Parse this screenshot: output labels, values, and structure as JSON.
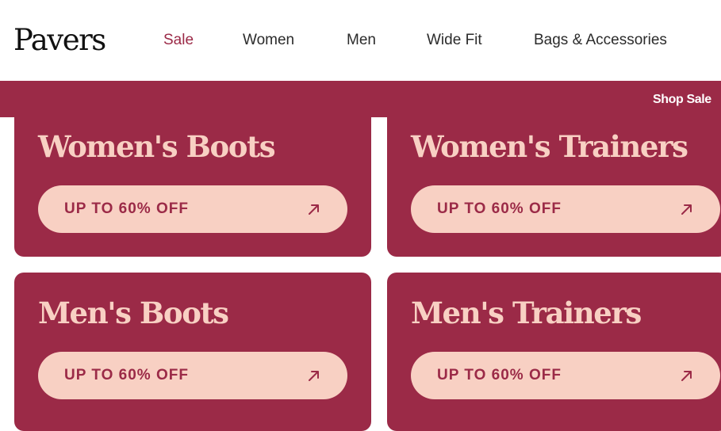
{
  "header": {
    "logo": "Pavers",
    "nav": [
      {
        "label": "Sale",
        "active": true
      },
      {
        "label": "Women",
        "active": false
      },
      {
        "label": "Men",
        "active": false
      },
      {
        "label": "Wide Fit",
        "active": false
      },
      {
        "label": "Bags & Accessories",
        "active": false
      }
    ]
  },
  "promo_bar": {
    "text": "Shop Sale"
  },
  "cards": [
    {
      "title": "Women's Boots",
      "cta": "UP TO 60% OFF",
      "icon": "arrow-up-right-icon"
    },
    {
      "title": "Women's Trainers",
      "cta": "UP TO 60% OFF",
      "icon": "arrow-up-right-icon"
    },
    {
      "title": "Men's Boots",
      "cta": "UP TO 60% OFF",
      "icon": "arrow-up-right-icon"
    },
    {
      "title": "Men's Trainers",
      "cta": "UP TO 60% OFF",
      "icon": "arrow-up-right-icon"
    }
  ],
  "colors": {
    "brand": "#9b2a47",
    "pill": "#f8d0c3",
    "text_dark": "#2b2b2b",
    "background": "#ffffff"
  }
}
